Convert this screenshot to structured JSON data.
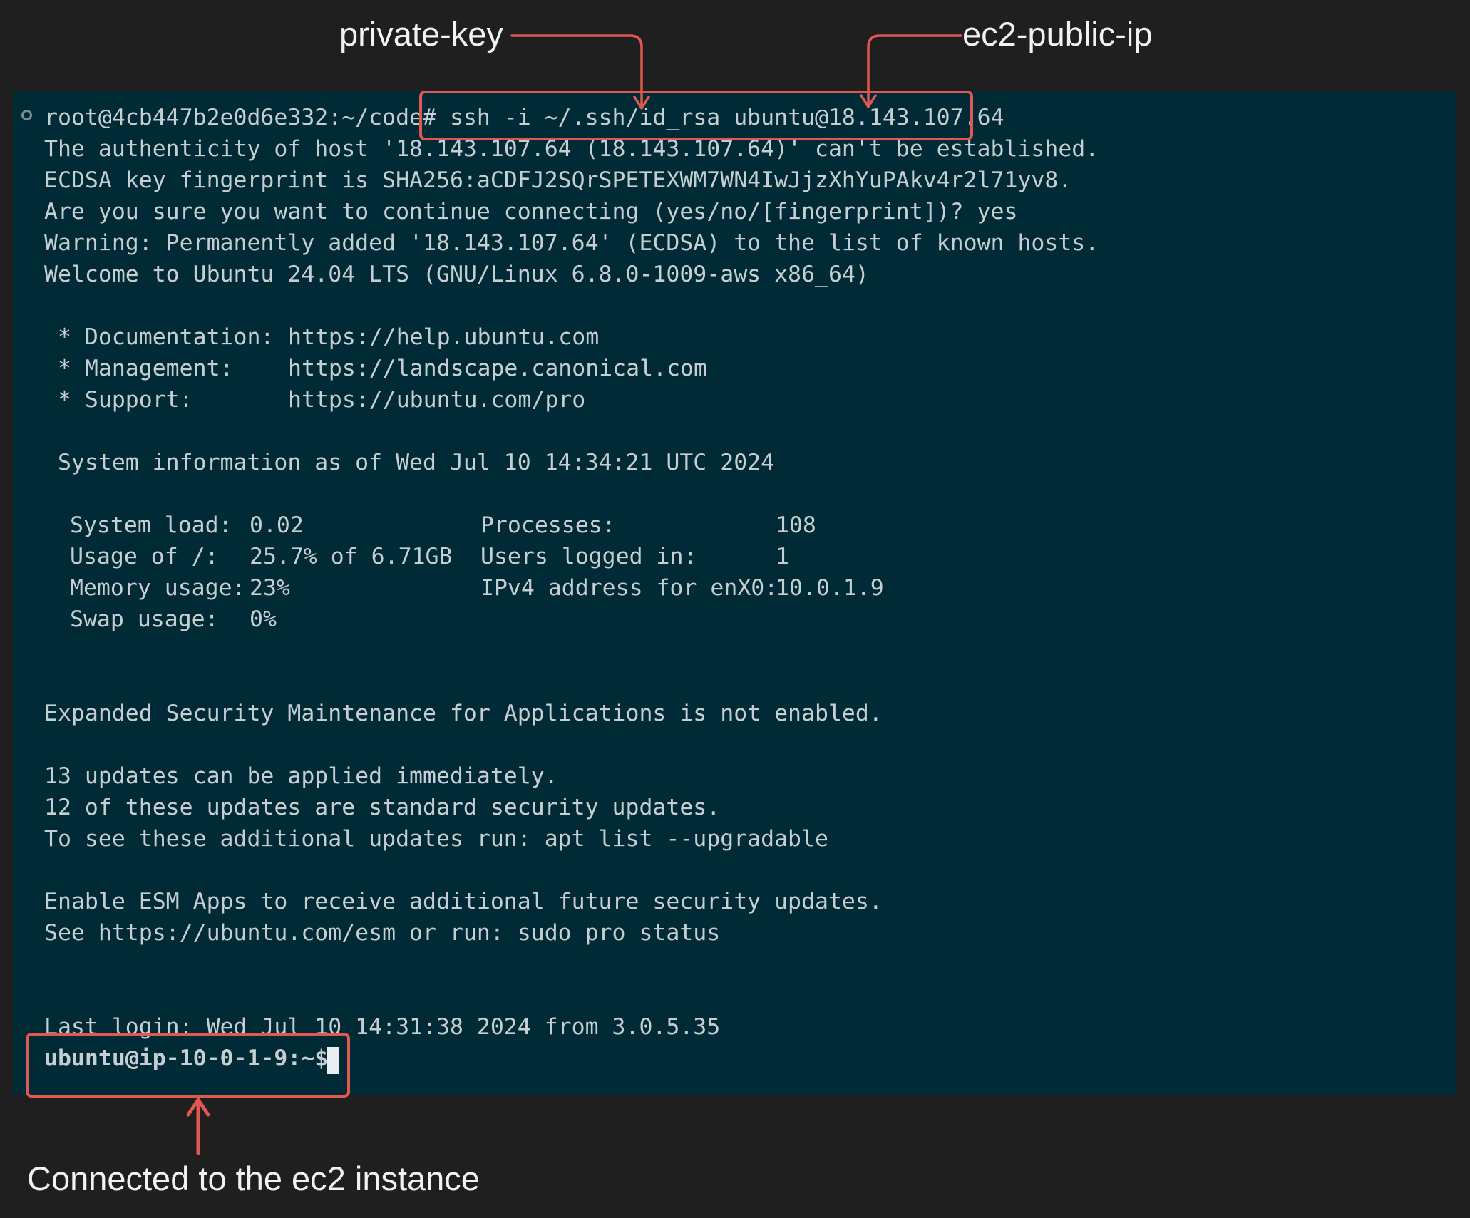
{
  "annotations": {
    "private_key": "private-key",
    "ec2_public_ip": "ec2-public-ip",
    "connected": "Connected to the ec2 instance"
  },
  "terminal": {
    "prompt_root": "root@4cb447b2e0d6e332:~/code#",
    "command": "ssh -i ~/.ssh/id_rsa ubuntu@18.143.107.64",
    "lines": [
      "The authenticity of host '18.143.107.64 (18.143.107.64)' can't be established.",
      "ECDSA key fingerprint is SHA256:aCDFJ2SQrSPETEXWM7WN4IwJjzXhYuPAkv4r2l71yv8.",
      "Are you sure you want to continue connecting (yes/no/[fingerprint])? yes",
      "Warning: Permanently added '18.143.107.64' (ECDSA) to the list of known hosts.",
      "Welcome to Ubuntu 24.04 LTS (GNU/Linux 6.8.0-1009-aws x86_64)"
    ],
    "links": [
      {
        "label": " * Documentation:",
        "url": "https://help.ubuntu.com"
      },
      {
        "label": " * Management:",
        "url": "https://landscape.canonical.com"
      },
      {
        "label": " * Support:",
        "url": "https://ubuntu.com/pro"
      }
    ],
    "sysinfo_header": " System information as of Wed Jul 10 14:34:21 UTC 2024",
    "sysinfo_left": [
      {
        "label": "System load:",
        "value": "0.02"
      },
      {
        "label": "Usage of /:",
        "value": "25.7% of 6.71GB"
      },
      {
        "label": "Memory usage:",
        "value": "23%"
      },
      {
        "label": "Swap usage:",
        "value": "0%"
      }
    ],
    "sysinfo_right": [
      {
        "label": "Processes:",
        "value": "108"
      },
      {
        "label": "Users logged in:",
        "value": "1"
      },
      {
        "label": "IPv4 address for enX0:",
        "value": "10.0.1.9"
      }
    ],
    "esm_line": "Expanded Security Maintenance for Applications is not enabled.",
    "updates": [
      "13 updates can be applied immediately.",
      "12 of these updates are standard security updates.",
      "To see these additional updates run: apt list --upgradable"
    ],
    "esm_apps": [
      "Enable ESM Apps to receive additional future security updates.",
      "See https://ubuntu.com/esm or run: sudo pro status"
    ],
    "last_login": "Last login: Wed Jul 10 14:31:38 2024 from 3.0.5.35",
    "prompt_ubuntu": "ubuntu@ip-10-0-1-9:~$"
  },
  "colors": {
    "terminal_bg": "#002b36",
    "page_bg": "#1f1f1f",
    "annotation_red": "#e0584f",
    "text": "#c6ced2"
  }
}
